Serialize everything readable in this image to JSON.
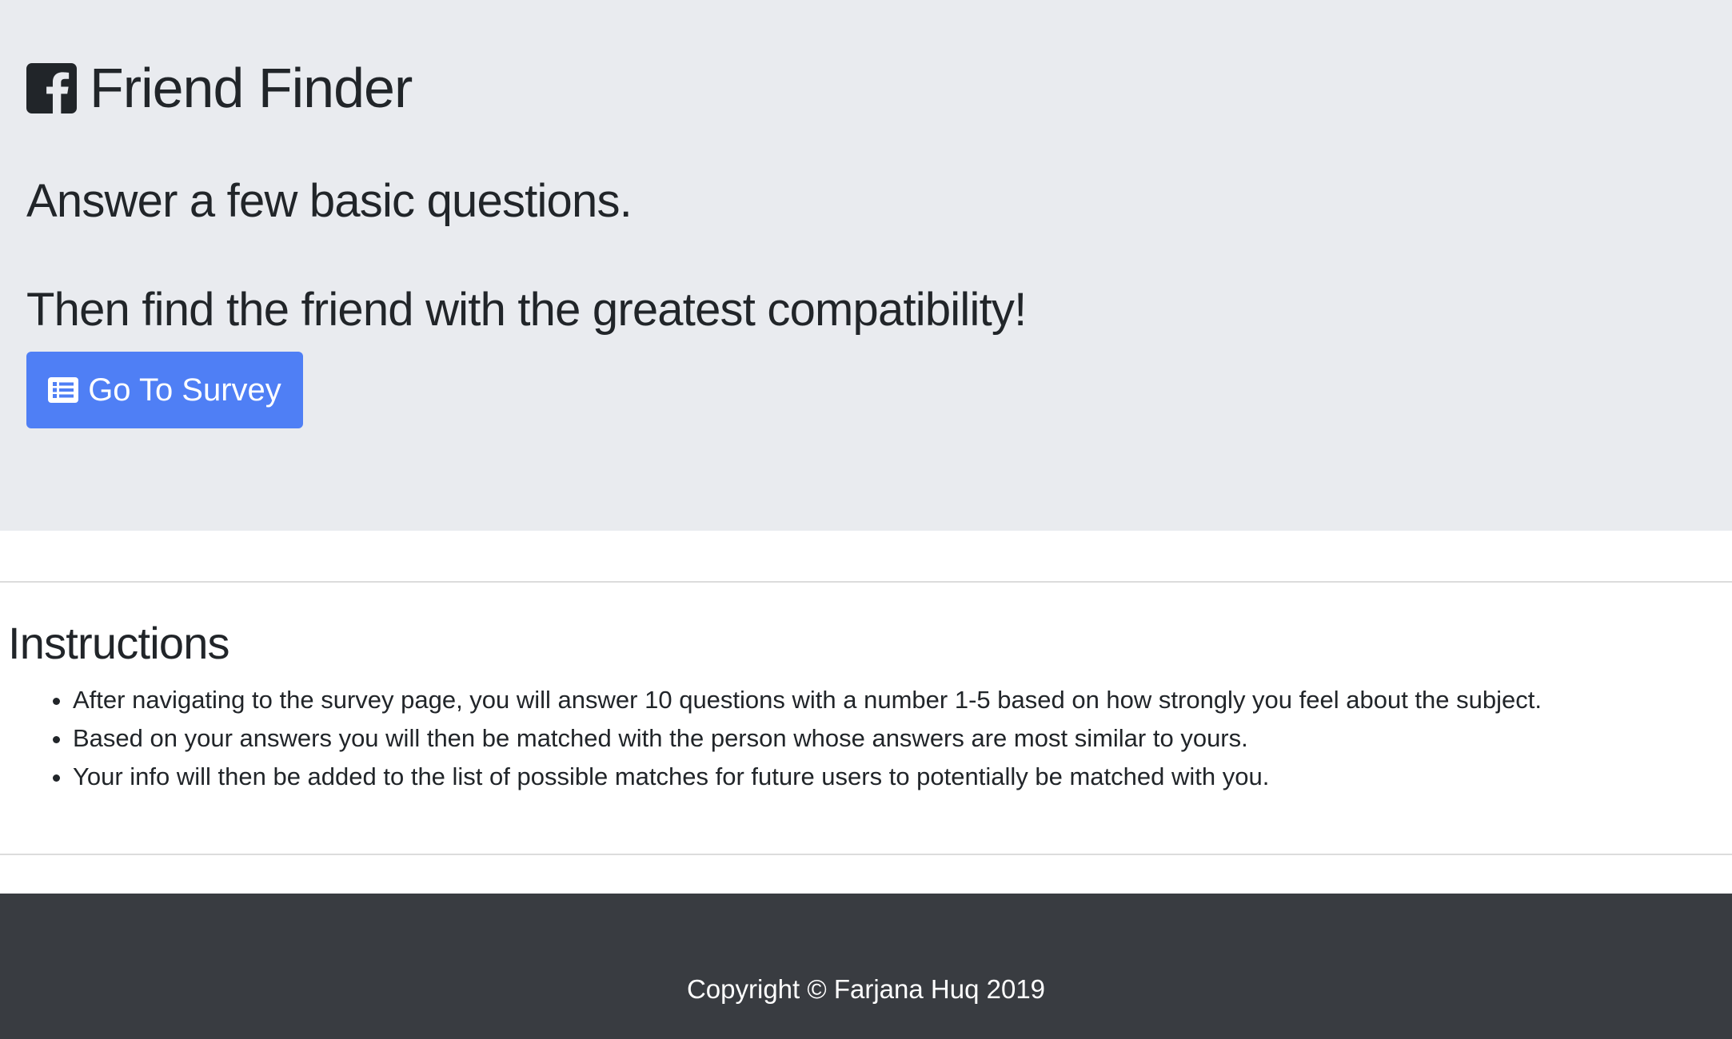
{
  "header": {
    "app_title": "Friend Finder",
    "logo_icon": "facebook-square-icon",
    "tagline_1": "Answer a few basic questions.",
    "tagline_2": "Then find the friend with the greatest compatibility!",
    "survey_button_label": "Go To Survey",
    "survey_button_icon": "list-alt-icon"
  },
  "instructions": {
    "title": "Instructions",
    "items": [
      "After navigating to the survey page, you will answer 10 questions with a number 1-5 based on how strongly you feel about the subject.",
      "Based on your answers you will then be matched with the person whose answers are most similar to yours.",
      "Your info will then be added to the list of possible matches for future users to potentially be matched with you."
    ]
  },
  "footer": {
    "copyright": "Copyright © Farjana Huq 2019"
  },
  "colors": {
    "jumbotron_bg": "#e9ebef",
    "button_bg": "#4f7ff5",
    "footer_bg": "#393c41",
    "text": "#212529"
  }
}
